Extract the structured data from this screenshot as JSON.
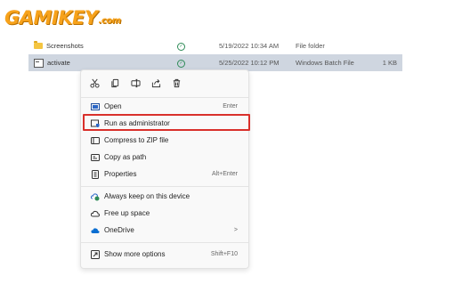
{
  "logo": {
    "text": "GAMIKEY",
    "suffix": ".com"
  },
  "files": [
    {
      "name": "Screenshots",
      "icon": "folder-icon",
      "date": "5/19/2022 10:34 AM",
      "type": "File folder",
      "size": ""
    },
    {
      "name": "activate",
      "icon": "batch-file-icon",
      "date": "5/25/2022 10:12 PM",
      "type": "Windows Batch File",
      "size": "1 KB"
    }
  ],
  "quick_actions": [
    "cut-icon",
    "copy-icon",
    "rename-icon",
    "share-icon",
    "delete-icon"
  ],
  "menu": {
    "open": {
      "label": "Open",
      "shortcut": "Enter"
    },
    "run_admin": {
      "label": "Run as administrator"
    },
    "compress": {
      "label": "Compress to ZIP file"
    },
    "copy_path": {
      "label": "Copy as path"
    },
    "properties": {
      "label": "Properties",
      "shortcut": "Alt+Enter"
    },
    "keep": {
      "label": "Always keep on this device"
    },
    "free": {
      "label": "Free up space"
    },
    "onedrive": {
      "label": "OneDrive",
      "shortcut": ">"
    },
    "more": {
      "label": "Show more options",
      "shortcut": "Shift+F10"
    }
  },
  "colors": {
    "highlight": "#d9302b",
    "selected_row": "#cfd6e0",
    "logo": "#f7a21b"
  }
}
